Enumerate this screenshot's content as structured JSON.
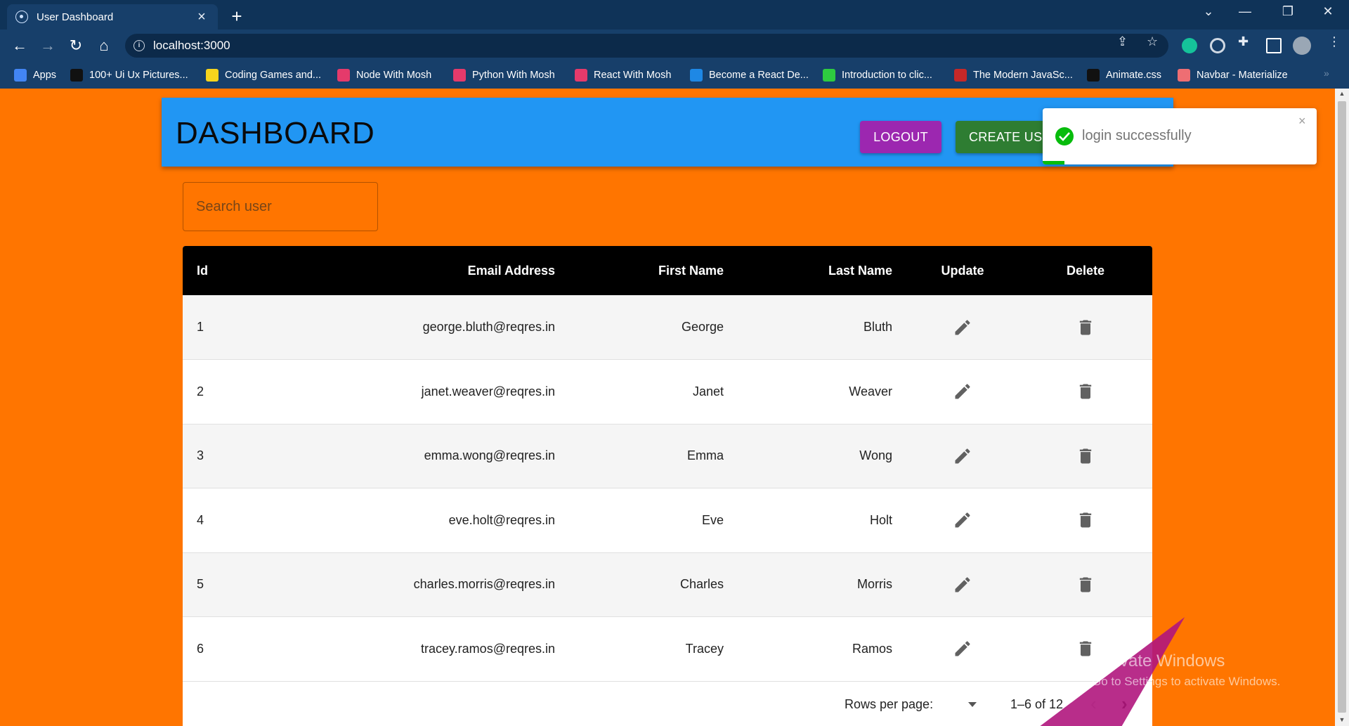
{
  "browser": {
    "tab_title": "User Dashboard",
    "tab_close": "×",
    "new_tab": "+",
    "url": "localhost:3000",
    "bookmarks": [
      {
        "label": "Apps",
        "color": "#4285f4"
      },
      {
        "label": "100+ Ui Ux Pictures...",
        "color": "#111111"
      },
      {
        "label": "Coding Games and...",
        "color": "#f7d51d"
      },
      {
        "label": "Node With Mosh",
        "color": "#e53a6b"
      },
      {
        "label": "Python With Mosh",
        "color": "#e53a6b"
      },
      {
        "label": "React With Mosh",
        "color": "#e53a6b"
      },
      {
        "label": "Become a React De...",
        "color": "#1e88e5"
      },
      {
        "label": "Introduction to clic...",
        "color": "#2ecc40"
      },
      {
        "label": "The Modern JavaSc...",
        "color": "#c62828"
      },
      {
        "label": "Animate.css",
        "color": "#111111"
      },
      {
        "label": "Navbar - Materialize",
        "color": "#ee6e73"
      }
    ],
    "bookmarks_more": "»"
  },
  "header": {
    "title": "DASHBOARD",
    "logout_label": "LOGOUT",
    "create_label": "CREATE USER"
  },
  "search": {
    "placeholder": "Search user"
  },
  "table": {
    "columns": [
      "Id",
      "Email Address",
      "First Name",
      "Last Name",
      "Update",
      "Delete"
    ],
    "rows": [
      {
        "id": "1",
        "email": "george.bluth@reqres.in",
        "first": "George",
        "last": "Bluth"
      },
      {
        "id": "2",
        "email": "janet.weaver@reqres.in",
        "first": "Janet",
        "last": "Weaver"
      },
      {
        "id": "3",
        "email": "emma.wong@reqres.in",
        "first": "Emma",
        "last": "Wong"
      },
      {
        "id": "4",
        "email": "eve.holt@reqres.in",
        "first": "Eve",
        "last": "Holt"
      },
      {
        "id": "5",
        "email": "charles.morris@reqres.in",
        "first": "Charles",
        "last": "Morris"
      },
      {
        "id": "6",
        "email": "tracey.ramos@reqres.in",
        "first": "Tracey",
        "last": "Ramos"
      }
    ]
  },
  "pagination": {
    "rows_per_page_label": "Rows per page:",
    "range": "1–6 of 12",
    "prev": "‹",
    "next": "›"
  },
  "toast": {
    "message": "login successfully",
    "close": "×",
    "status_color": "#07bc0c",
    "progress": 0.08
  },
  "watermark": {
    "title": "Activate Windows",
    "subtitle": "Go to Settings to activate Windows."
  },
  "colors": {
    "page_bg": "#ff7500",
    "header_bg": "#2196f3",
    "logout_bg": "#9c27b0",
    "create_bg": "#2e7d32"
  }
}
